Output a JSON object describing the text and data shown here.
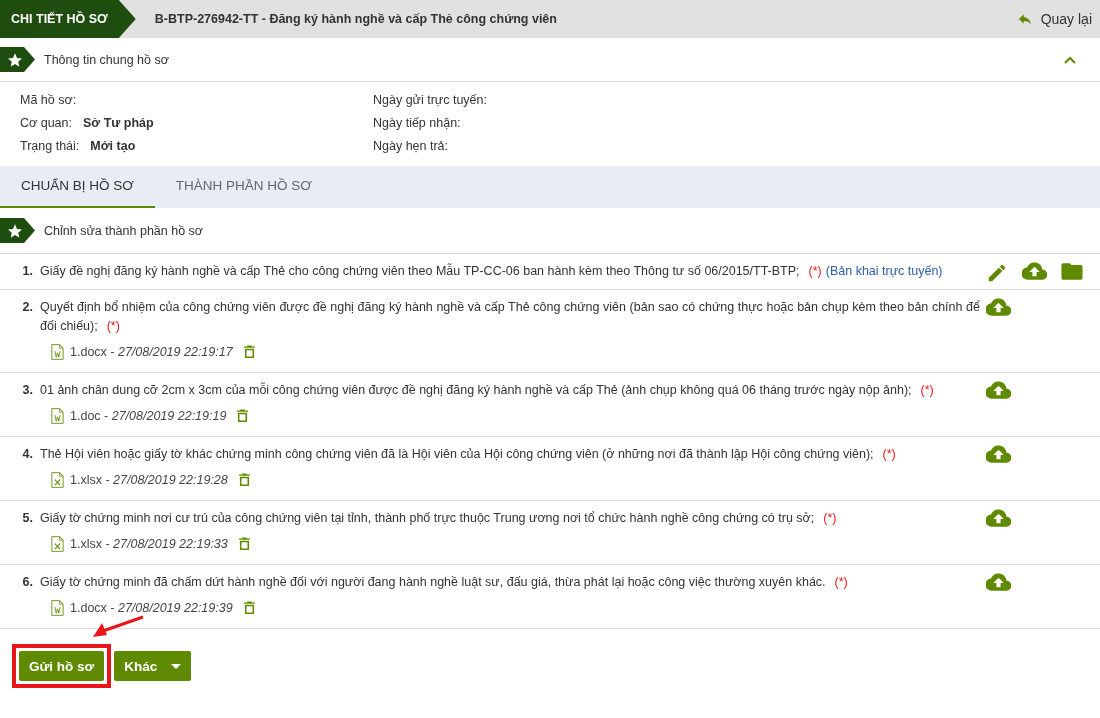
{
  "header": {
    "badge": "CHI TIẾT HỒ SƠ",
    "title": "B-BTP-276942-TT - Đăng ký hành nghề và cấp Thẻ công chứng viên",
    "back": "Quay lại"
  },
  "general_section": {
    "title": "Thông tin chung hồ sơ",
    "expanded": true,
    "fields_left": [
      {
        "label": "Mã hồ sơ:"
      },
      {
        "label": "Cơ quan:",
        "value": "Sở Tư pháp"
      },
      {
        "label": "Trạng thái:",
        "value": "Mới tạo"
      }
    ],
    "fields_right": [
      {
        "label": "Ngày gửi trực tuyến:"
      },
      {
        "label": "Ngày tiếp nhận:"
      },
      {
        "label": "Ngày hẹn trả:"
      }
    ]
  },
  "tabs": [
    {
      "label": "CHUẨN BỊ HỒ SƠ",
      "selected": true
    },
    {
      "label": "THÀNH PHẦN HỒ SƠ",
      "selected": false
    }
  ],
  "edit_section": {
    "title": "Chỉnh sửa thành phần hồ sơ"
  },
  "documents": [
    {
      "number": "1.",
      "text": "Giấy đề nghị đăng ký hành nghề và cấp Thẻ cho công chứng viên theo Mẫu TP-CC-06 ban hành kèm theo Thông tư số 06/2015/TT-BTP;",
      "required_mark": "(*)",
      "link": "(Bản khai trực tuyến)",
      "actions": [
        {
          "kind": "edit"
        },
        {
          "kind": "upload"
        },
        {
          "kind": "folder"
        }
      ]
    },
    {
      "number": "2.",
      "text": "Quyết định bổ nhiệm của công chứng viên được đề nghị đăng ký hành nghề và cấp Thẻ công chứng viên (bản sao có chứng thực hoặc bản chụp kèm theo bản chính để đối chiếu);",
      "required_mark": "(*)",
      "actions": [
        {
          "kind": "upload"
        }
      ],
      "files": [
        {
          "kind": "word",
          "label": "1.docx - *27/08/2019 22:19:17*"
        }
      ]
    },
    {
      "number": "3.",
      "text": "01 ảnh chân dung cỡ 2cm x 3cm của mỗi công chứng viên được đề nghị đăng ký hành nghề và cấp Thẻ (ảnh chụp không quá 06 tháng trước ngày nộp ảnh);",
      "required_mark": "(*)",
      "actions": [
        {
          "kind": "upload"
        }
      ],
      "files": [
        {
          "kind": "word",
          "label": "1.doc - *27/08/2019 22:19:19*"
        }
      ]
    },
    {
      "number": "4.",
      "text": "Thẻ Hội viên hoặc giấy tờ khác chứng minh công chứng viên đã là Hội viên của Hội công chứng viên (ở những nơi đã thành lập Hội công chứng viên);",
      "required_mark": "(*)",
      "actions": [
        {
          "kind": "upload"
        }
      ],
      "files": [
        {
          "kind": "excel",
          "label": "1.xlsx - *27/08/2019 22:19:28*"
        }
      ]
    },
    {
      "number": "5.",
      "text": "Giấy tờ chứng minh nơi cư trú của công chứng viên tại tỉnh, thành phố trực thuộc Trung ương nơi tổ chức hành nghề công chứng có trụ sở;",
      "required_mark": "(*)",
      "actions": [
        {
          "kind": "upload"
        }
      ],
      "files": [
        {
          "kind": "excel",
          "label": "1.xlsx - *27/08/2019 22:19:33*"
        }
      ]
    },
    {
      "number": "6.",
      "text": "Giấy tờ chứng minh đã chấm dứt hành nghề đối với người đang hành nghề luật sư, đấu giá, thừa phát lại hoặc công việc thường xuyên khác.",
      "required_mark": "(*)",
      "actions": [
        {
          "kind": "upload"
        }
      ],
      "files": [
        {
          "kind": "word",
          "label": "1.docx - *27/08/2019 22:19:39*"
        }
      ]
    }
  ],
  "buttons": [
    {
      "kind": "primary",
      "label": "Gửi hồ sơ",
      "highlighted": true
    },
    {
      "kind": "dropdown",
      "label": "Khác",
      "highlighted": false
    }
  ]
}
